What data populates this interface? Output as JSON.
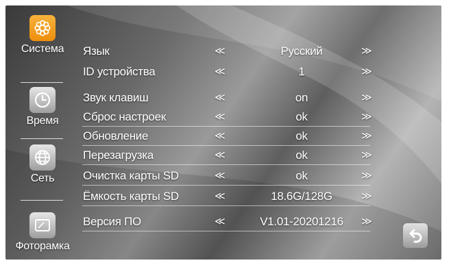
{
  "sidebar": {
    "items": [
      {
        "label": "Система",
        "icon": "settings-gear-icon",
        "active": true
      },
      {
        "label": "Время",
        "icon": "clock-icon",
        "active": false
      },
      {
        "label": "Сеть",
        "icon": "globe-icon",
        "active": false
      },
      {
        "label": "Фоторамка",
        "icon": "photo-frame-icon",
        "active": false
      }
    ]
  },
  "settings": {
    "left_arrow": "≪",
    "right_arrow": "≫",
    "rows": [
      {
        "label": "Язык",
        "value": "Русский"
      },
      {
        "label": "ID устройства",
        "value": "1"
      },
      {
        "label": "Звук клавиш",
        "value": "on"
      },
      {
        "label": "Сброс настроек",
        "value": "ok"
      },
      {
        "label": "Обновление",
        "value": "ok"
      },
      {
        "label": "Перезагрузка",
        "value": "ok"
      },
      {
        "label": "Очистка карты SD",
        "value": "ok"
      },
      {
        "label": "Ёмкость карты SD",
        "value": "18.6G/128G"
      },
      {
        "label": "Версия ПО",
        "value": "V1.01-20201216"
      }
    ]
  },
  "colors": {
    "accent": "#f5a020",
    "icon_inactive": "#c8c8c8"
  },
  "back_button": {
    "icon": "back-arrow-icon"
  }
}
